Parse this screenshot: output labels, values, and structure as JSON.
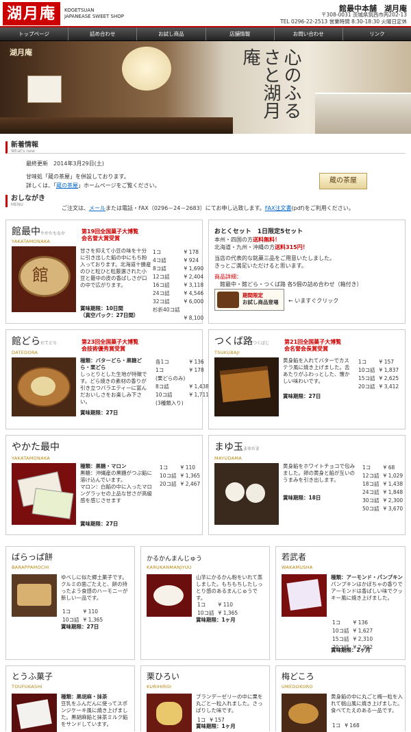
{
  "header": {
    "logo": "湖月庵",
    "brand_en_1": "KOGETSUAN",
    "brand_en_2": "JAPANEASE SWEET SHOP",
    "shop_name": "館最中本舗　湖月庵",
    "address": "〒308-0031 茨城県筑西市丙202-13",
    "contact": "TEL 0296-22-2513 営業時間 8:30-18:30 火曜日定休"
  },
  "nav": [
    "トップページ",
    "詰め合わせ",
    "お試し商品",
    "店舗情報",
    "お問い合わせ",
    "リンク"
  ],
  "hero": {
    "banner": "湖月庵",
    "calligraphy": "心のふるさと湖月庵"
  },
  "news": {
    "title": "新着情報",
    "subtitle": "What's new",
    "updated": "最終更新　2014年3月29日(土)",
    "line1": "甘味処「蔵の茶屋」を併設しております。",
    "line2_a": "詳しくは、「",
    "line2_link": "蔵の茶屋",
    "line2_b": "」ホームページをご覧ください。",
    "kura_logo": "蔵の茶屋"
  },
  "menu": {
    "title": "おしながき",
    "subtitle": "MENU",
    "note_a": "ご注文は、",
    "note_link1": "メール",
    "note_b": "または電話・FAX（0296－24－2683）にてお申し込致します。",
    "note_link2": "FAX注文書",
    "note_c": "(pdf)をご利用ください。"
  },
  "products": {
    "monaka": {
      "name": "館最中",
      "kana": "やかたもなか",
      "roman": "YAKATAMONAKA",
      "award1": "第19回全国菓子大博覧",
      "award2": "会名誉大賞受賞",
      "desc": "甘さを抑えて小豆の味を十分に引き出した餡の中にもち粉入っております。北海道十勝産のひと粒ひと粒厳選された小豆と最中の皮の香ばしさが口の中で広がります。",
      "prices": [
        [
          "1コ",
          "¥ 178"
        ],
        [
          "4コ詰",
          "¥ 924"
        ],
        [
          "8コ詰",
          "¥ 1,690"
        ],
        [
          "12コ詰",
          "¥ 2,404"
        ],
        [
          "16コ詰",
          "¥ 3,118"
        ],
        [
          "24コ詰",
          "¥ 4,546"
        ],
        [
          "32コ詰",
          "¥ 6,000"
        ],
        [
          "杉折40コ詰",
          ""
        ],
        [
          "",
          "¥ 8,100"
        ]
      ],
      "shelf1": "賞味期限：10日間",
      "shelf2": "（真空パック：27日間）"
    },
    "otoku": {
      "title": "おとくセット　1日限定5セット",
      "line1_a": "本州・四国の方",
      "line1_b": "送料無料！",
      "line2_a": "北海道・九州・沖縄の方",
      "line2_b": "送料315円！",
      "line3": "当店の代表的な銘菓三品をご用意いたしました。",
      "line4": "きっとご満足いただけると思います。",
      "detail_label": "商品詳細：",
      "detail": "館最中・館どら・つくば路 各5個の詰め合わせ（箱付き）",
      "btn1": "期間限定",
      "btn2": "お試し商品登場",
      "click": "← いますぐクリック"
    },
    "dora": {
      "name": "館どら",
      "kana": "だてどら",
      "roman": "DATEDORA",
      "award1": "第23回全国菓子大博覧",
      "award2": "会技術優秀賞受賞",
      "kinds": "種類：バターどら・黒糖どら・栗どら",
      "desc": "しっとりとした生地が特徴です。どら焼きの素材の香りが引き立つバラエティーに富んだおいしさをお楽しみ下さい。",
      "prices": [
        [
          "各1コ",
          "¥ 136"
        ],
        [
          "1コ",
          "¥ 178"
        ],
        [
          "(栗どらのみ)",
          ""
        ],
        [
          "8コ詰",
          "¥ 1,438"
        ],
        [
          "10コ詰",
          "¥ 1,711"
        ],
        [
          "(3種類入り)",
          ""
        ]
      ],
      "shelf": "賞味期限：27日"
    },
    "tsukuba": {
      "name": "つくば路",
      "kana": "つくばじ",
      "roman": "TSUKUBAJI",
      "award1": "第21回全国菓子大博覧",
      "award2": "会名誉会長賞受賞",
      "desc": "黄身餡を入れてバターでカステラ風に焼き上げました。舌あたりがふわっとした、懐かしい味わいです。",
      "prices": [
        [
          "1コ",
          "¥ 157"
        ],
        [
          "10コ詰",
          "¥ 1,837"
        ],
        [
          "15コ詰",
          "¥ 2,625"
        ],
        [
          "20コ詰",
          "¥ 3,412"
        ]
      ],
      "shelf": "賞味期限：27日"
    },
    "yakata": {
      "name": "やかた最中",
      "roman": "YAKATAMONAKA",
      "kinds1": "種類：黒糖・マロン",
      "kinds2": "黒糖：沖縄産の黒糖がつぶ餡に溶け込んでいます。",
      "kinds3": "マロン：白餡の中に入ったマロングラッセの上品な甘さが高級感を感じさせます",
      "prices": [
        [
          "1コ",
          "¥ 110"
        ],
        [
          "10コ詰",
          "¥ 1,365"
        ],
        [
          "20コ詰",
          "¥ 2,467"
        ]
      ],
      "shelf": "賞味期限：27日"
    },
    "mayu": {
      "name": "まゆ玉",
      "kana": "まゆだま",
      "roman": "MAYUDAMA",
      "desc": "黄身餡をホワイトチョコで包みました。卵の黄身と餡が互いのうまみを引き出します。",
      "prices": [
        [
          "1コ",
          "¥ 68"
        ],
        [
          "12コ詰",
          "¥ 1,029"
        ],
        [
          "18コ詰",
          "¥ 1,438"
        ],
        [
          "24コ詰",
          "¥ 1,848"
        ],
        [
          "30コ詰",
          "¥ 2,300"
        ],
        [
          "50コ詰",
          "¥ 3,670"
        ]
      ],
      "shelf": "賞味期限：18日"
    },
    "bara": {
      "name": "ばらっぱ餅",
      "roman": "BARAPPAMOCHI",
      "desc": "ゆべしに似た郷土菓子です。クルミの歯ごたえと、餅の持ったよう食感のハーモニーが新しい一品です。",
      "prices": [
        [
          "1コ",
          "¥ 110"
        ],
        [
          "10コ詰",
          "¥ 1,365"
        ]
      ],
      "shelf": "賞味期限：27日"
    },
    "karukan": {
      "name": "かるかんまんじゅう",
      "roman": "KARUKANMANJYUU",
      "desc": "山芋にかるかん粉をいれて蒸しました。もちもちしたしっとり感のあるまんじゅうです。",
      "prices": [
        [
          "1コ",
          "¥ 110"
        ],
        [
          "10コ詰",
          "¥ 1,365"
        ]
      ],
      "shelf": "賞味期限：1ヶ月"
    },
    "waka": {
      "name": "若武者",
      "roman": "WAKAMUSHA",
      "kinds": "種類：アーモンド・パンプキン",
      "desc": "パンプキンはかぼちゃの香りでアーモンドは香ばしい味でクッキー風に焼き上げました。",
      "prices": [
        [
          "1コ",
          "¥ 136"
        ],
        [
          "10コ詰",
          "¥ 1,627"
        ],
        [
          "15コ詰",
          "¥ 2,310"
        ],
        [
          "20コ詰",
          "¥ 2,992"
        ]
      ],
      "shelf": "賞味期限：2ヶ月"
    },
    "toufu": {
      "name": "とうふ菓子",
      "roman": "TOUFUKASHI",
      "kinds": "種類：黒胡麻・抹茶",
      "desc": "豆乳をふんだんに使ってスポンジケーキ風に焼き上げました。黒胡麻餡と抹茶ミルク餡をサンドしています。"
    },
    "kuri": {
      "name": "栗ひろい",
      "roman": "KURIHIROI",
      "desc": "ブランデーゼリーの中に栗を丸ごと一粒入れました。さっぱりした味です。",
      "prices": [
        [
          "1コ",
          "¥ 157"
        ]
      ],
      "shelf": "賞味期限：1ヶ月"
    },
    "ume": {
      "name": "梅どころ",
      "roman": "UMEDOKORO",
      "desc": "黄身餡の中に丸ごと梅一粒を入れて桃山風に焼き上げました。食べてたえのある一品です。",
      "prices": [
        [
          "1コ",
          "¥ 168"
        ]
      ]
    }
  }
}
